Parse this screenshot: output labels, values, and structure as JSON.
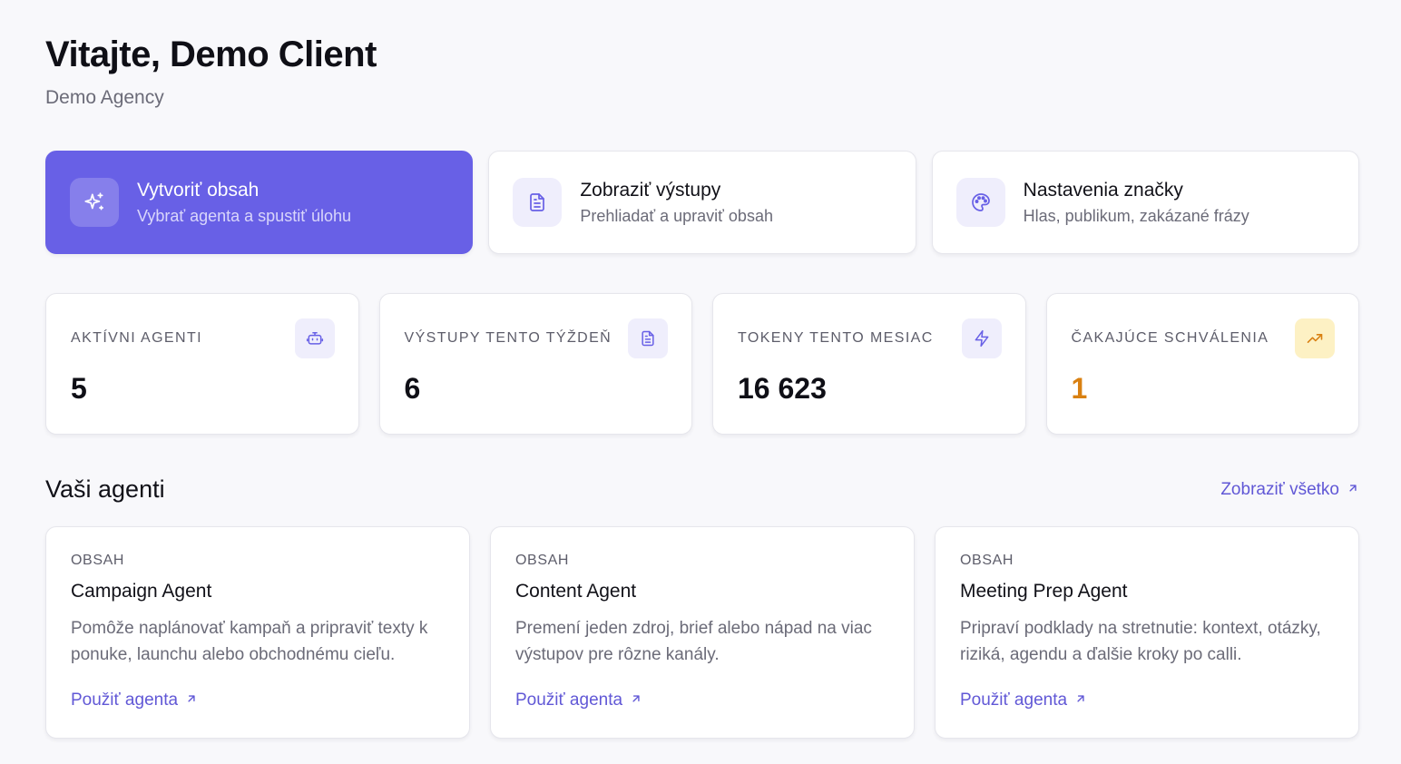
{
  "header": {
    "title": "Vitajte, Demo Client",
    "subtitle": "Demo Agency"
  },
  "actions": [
    {
      "title": "Vytvoriť obsah",
      "description": "Vybrať agenta a spustiť úlohu",
      "icon": "sparkles-icon",
      "primary": true
    },
    {
      "title": "Zobraziť výstupy",
      "description": "Prehliadať a upraviť obsah",
      "icon": "document-icon"
    },
    {
      "title": "Nastavenia značky",
      "description": "Hlas, publikum, zakázané frázy",
      "icon": "palette-icon"
    }
  ],
  "stats": [
    {
      "label": "AKTÍVNI AGENTI",
      "value": "5",
      "icon": "robot-icon"
    },
    {
      "label": "VÝSTUPY TENTO TÝŽDEŇ",
      "value": "6",
      "icon": "document-icon"
    },
    {
      "label": "TOKENY TENTO MESIAC",
      "value": "16 623",
      "icon": "lightning-icon"
    },
    {
      "label": "ČAKAJÚCE SCHVÁLENIA",
      "value": "1",
      "icon": "trending-up-icon",
      "accent": "#d98011"
    }
  ],
  "agents_section": {
    "title": "Vaši agenti",
    "view_all": "Zobraziť všetko"
  },
  "agents": [
    {
      "category": "OBSAH",
      "name": "Campaign Agent",
      "description": "Pomôže naplánovať kampaň a pripraviť texty k ponuke, launchu alebo obchodnému cieľu.",
      "link": "Použiť agenta"
    },
    {
      "category": "OBSAH",
      "name": "Content Agent",
      "description": "Premení jeden zdroj, brief alebo nápad na viac výstupov pre rôzne kanály.",
      "link": "Použiť agenta"
    },
    {
      "category": "OBSAH",
      "name": "Meeting Prep Agent",
      "description": "Pripraví podklady na stretnutie: kontext, otázky, riziká, agendu a ďalšie kroky po calli.",
      "link": "Použiť agenta"
    }
  ],
  "colors": {
    "accent": "#6860e6",
    "link": "#6158d6",
    "warning": "#d98011"
  }
}
